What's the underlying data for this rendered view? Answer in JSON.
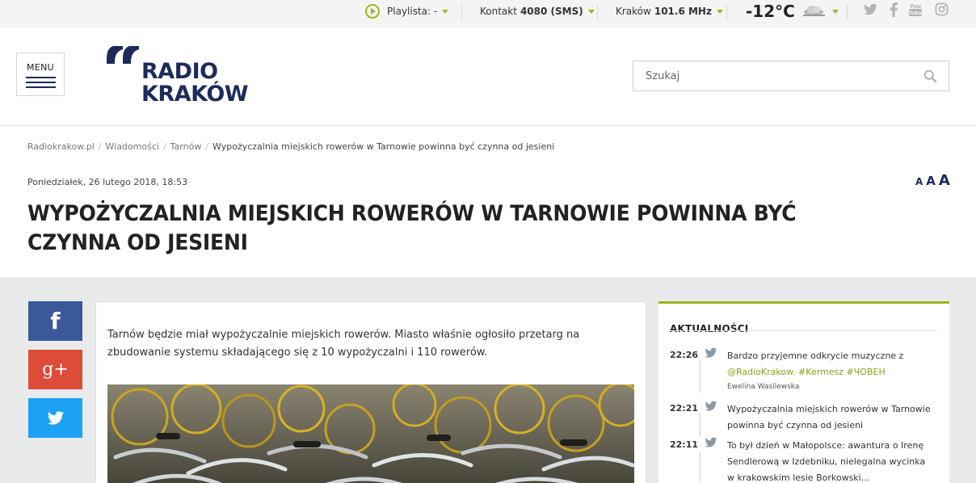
{
  "topbar": {
    "playlist_label": "Playlista: -",
    "contact_label": "Kontakt",
    "contact_value": "4080 (SMS)",
    "station_label": "Kraków",
    "station_freq": "101.6 MHz",
    "temperature": "-12°C",
    "weather_icon": "cloud-icon",
    "social_icons": [
      "twitter-icon",
      "facebook-icon",
      "youtube-icon",
      "instagram-icon"
    ]
  },
  "header": {
    "menu_label": "MENU",
    "logo_line1": "RADIO",
    "logo_line2": "KRAKÓW",
    "search_placeholder": "Szukaj"
  },
  "breadcrumb": {
    "items": [
      "Radiokrakow.pl",
      "Wiadomości",
      "Tarnów"
    ],
    "current": "Wypożyczalnia miejskich rowerów w Tarnowie powinna być czynna od jesieni"
  },
  "article": {
    "date": "Poniedziałek, 26 lutego 2018, 18:53",
    "font_sizes": [
      "A",
      "A",
      "A"
    ],
    "title": "Wypożyczalnia miejskich rowerów w Tarnowie powinna być czynna od jesieni",
    "lead": "Tarnów będzie miał wypożyczalnie miejskich rowerów. Miasto właśnie ogłosiło przetarg na zbudowanie systemu składającego się z 10 wypożyczalni i 110 rowerów."
  },
  "share": {
    "facebook": "f",
    "googleplus": "g+"
  },
  "news": {
    "title": "AKTUALNOŚCI",
    "items": [
      {
        "time": "22:26",
        "text_before": "Bardzo przyjemne odkrycie muzyczne z ",
        "highlight": "@RadioKrakow. #Kermesz #ЧОВЕН",
        "author": "Ewelina Wasilewska"
      },
      {
        "time": "22:21",
        "text": "Wypożyczalnia miejskich rowerów w Tarnowie powinna być czynna od jesieni"
      },
      {
        "time": "22:11",
        "text": "To był dzień w Małopolsce: awantura o Irenę Sendlerową w Izdebniku, nielegalna wycinka w krakowskim lesie Borkowski..."
      }
    ]
  },
  "colors": {
    "accent": "#a0b41e",
    "brand": "#1d2a5c",
    "facebook": "#3b5998",
    "googleplus": "#dd4b39",
    "twitter": "#1da1f2"
  }
}
